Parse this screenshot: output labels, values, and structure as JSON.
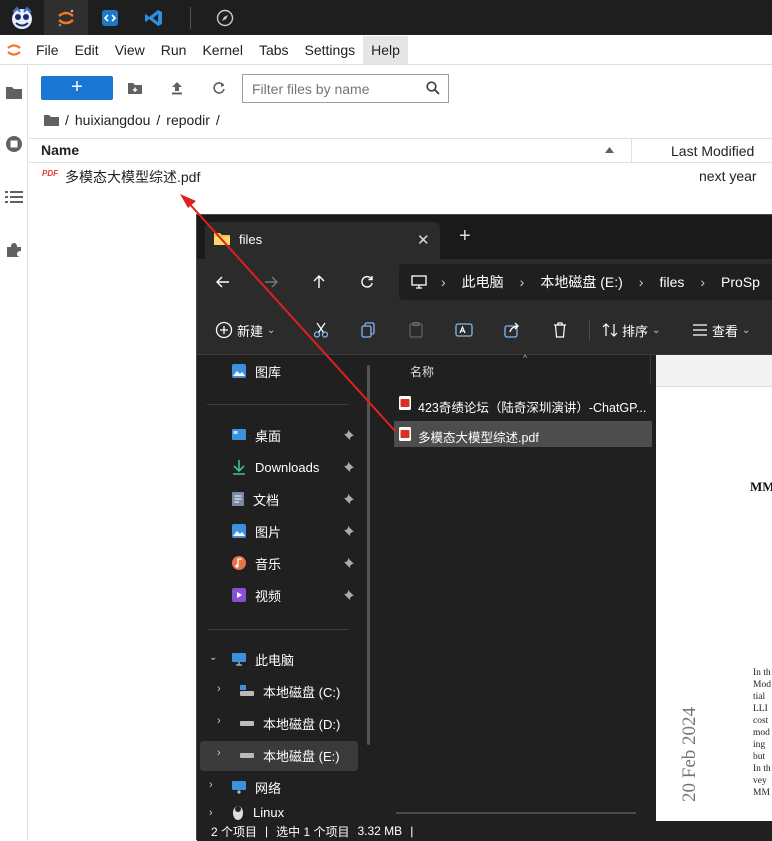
{
  "menu": [
    "File",
    "Edit",
    "View",
    "Run",
    "Kernel",
    "Tabs",
    "Settings",
    "Help"
  ],
  "filebrowser": {
    "new_label": "+",
    "filter_placeholder": "Filter files by name",
    "breadcrumb": [
      "/",
      "huixiangdou",
      "/",
      "repodir",
      "/"
    ],
    "col_name": "Name",
    "col_modified": "Last Modified",
    "file": {
      "name": "多模态大模型综述.pdf",
      "modified": "next year",
      "icon_text": "PDF"
    }
  },
  "explorer": {
    "tab_title": "files",
    "address": [
      "此电脑",
      "本地磁盘 (E:)",
      "files",
      "ProSp"
    ],
    "commands": {
      "new": "新建",
      "sort": "排序",
      "view": "查看"
    },
    "nav_top": "图库",
    "quick_access": [
      "桌面",
      "Downloads",
      "文档",
      "图片",
      "音乐",
      "视频"
    ],
    "this_pc": "此电脑",
    "drives": [
      "本地磁盘 (C:)",
      "本地磁盘 (D:)",
      "本地磁盘 (E:)"
    ],
    "network": "网络",
    "linux": "Linux",
    "col_name": "名称",
    "files": [
      "423奇绩论坛（陆奇深圳演讲）-ChatGP...",
      "多模态大模型综述.pdf"
    ],
    "status": [
      "2 个项目",
      "|",
      "选中 1 个项目",
      "3.32 MB",
      "|"
    ],
    "preview": {
      "heading": "MM",
      "date": "20 Feb 2024",
      "lines": [
        "In th",
        "Mod",
        "tial",
        "LLI",
        "cost",
        "mod",
        "ing",
        "but",
        "In th",
        "vey",
        "MM"
      ]
    }
  },
  "colors": {
    "jupyter_blue": "#1976d2",
    "arrow": "#e02020",
    "pdf_red": "#e53935"
  }
}
